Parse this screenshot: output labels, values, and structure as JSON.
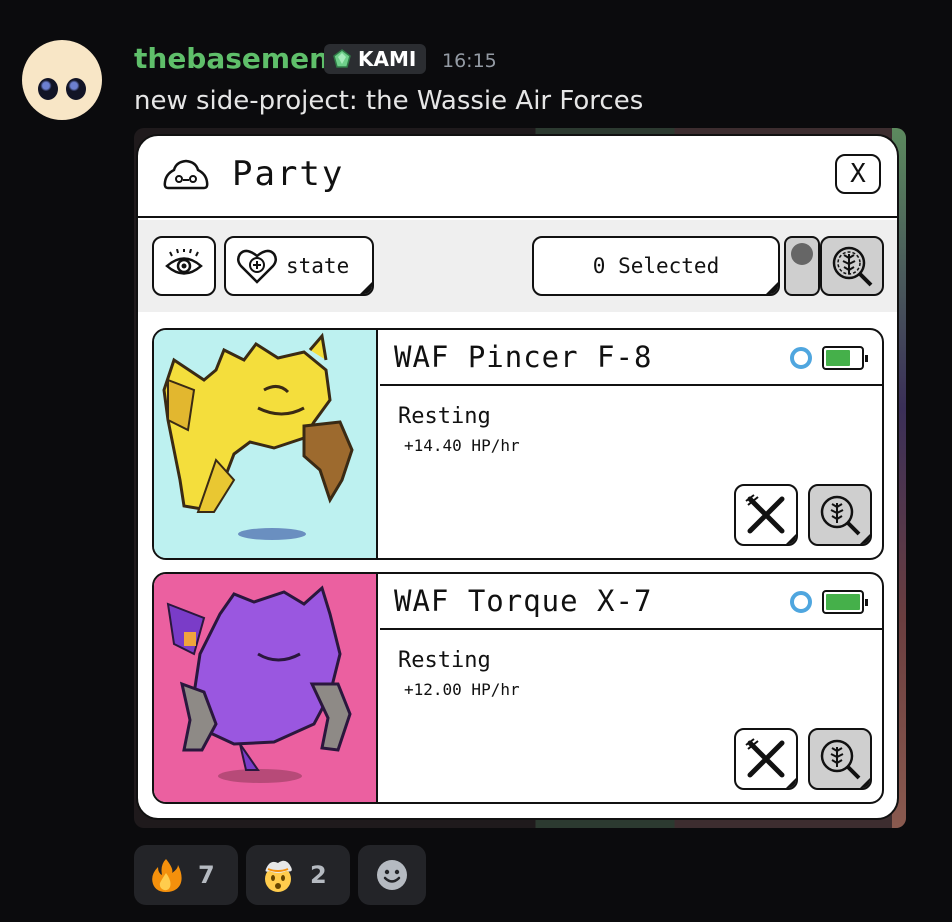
{
  "message": {
    "username": "thebasement",
    "tag": "KAMI",
    "time": "16:15",
    "text": "new side-project: the Wassie Air Forces"
  },
  "panel": {
    "title": "Party",
    "close_label": "X",
    "toolbar": {
      "state_label": "state",
      "selected_label": "0 Selected"
    },
    "cards": [
      {
        "name": "WAF Pincer F-8",
        "state": "Resting",
        "rate": "+14.40 HP/hr",
        "battery_level": 0.7,
        "portrait_color": "#bdf1f0"
      },
      {
        "name": "WAF Torque X-7",
        "state": "Resting",
        "rate": "+12.00 HP/hr",
        "battery_level": 1.0,
        "portrait_color": "#eb60a0"
      }
    ]
  },
  "reactions": [
    {
      "emoji": "fire",
      "count": "7"
    },
    {
      "emoji": "exploding-head",
      "count": "2"
    },
    {
      "emoji": "add-reaction",
      "count": ""
    }
  ],
  "colors": {
    "username": "#5fbf6a",
    "status_ring": "#4fa6df",
    "battery": "#45b04a"
  }
}
